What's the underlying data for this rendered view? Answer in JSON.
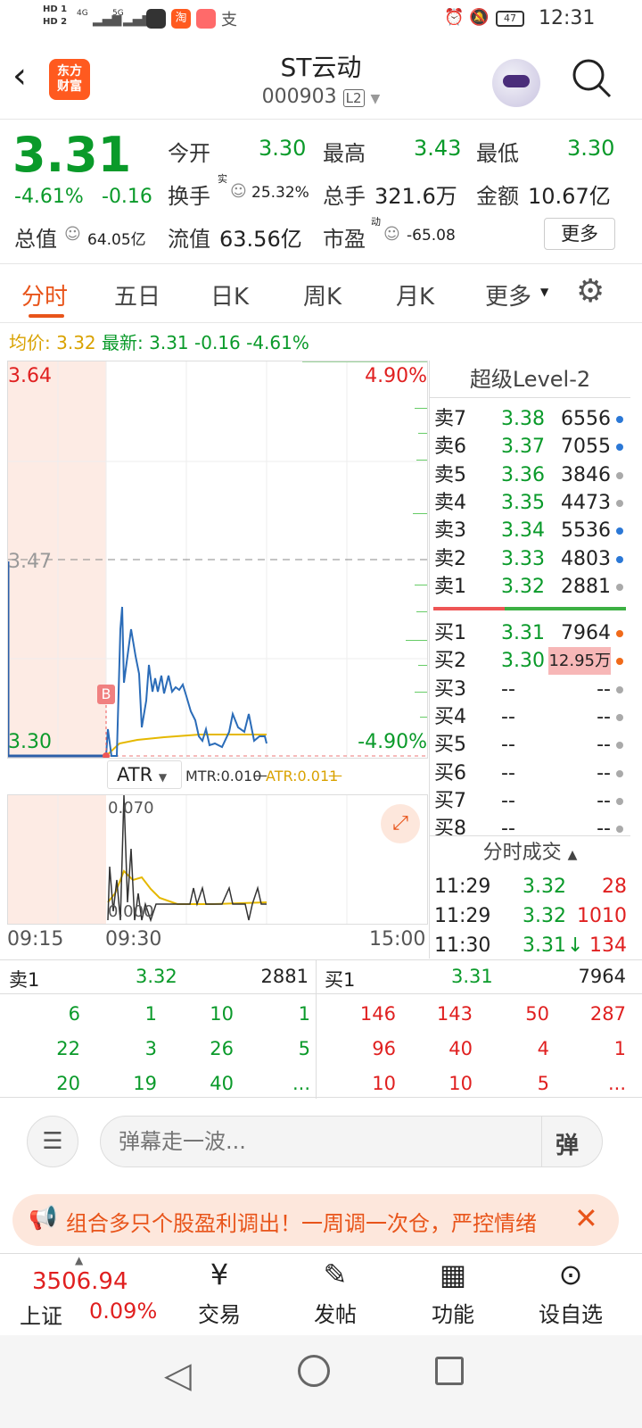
{
  "status_bar": {
    "sim1": "HD 1",
    "sim2": "HD 2",
    "net1": "4G",
    "net2": "5G",
    "battery": "47",
    "time": "12:31"
  },
  "header": {
    "logo_line1": "东方",
    "logo_line2": "财富",
    "title": "ST云动",
    "code": "000903",
    "level_badge": "L2"
  },
  "quote": {
    "price": "3.31",
    "change_pct": "-4.61%",
    "change": "-0.16",
    "open_label": "今开",
    "open": "3.30",
    "high_label": "最高",
    "high": "3.43",
    "low_label": "最低",
    "low": "3.30",
    "turnover_label": "换手",
    "turnover_sup": "实",
    "turnover": "25.32%",
    "volume_label": "总手",
    "volume": "321.6万",
    "amount_label": "金额",
    "amount": "10.67亿",
    "mktcap_label": "总值",
    "mktcap": "64.05亿",
    "float_label": "流值",
    "float": "63.56亿",
    "pe_label": "市盈",
    "pe_sup": "动",
    "pe": "-65.08",
    "more_button": "更多"
  },
  "tabs": [
    "分时",
    "五日",
    "日K",
    "周K",
    "月K",
    "更多"
  ],
  "info_line": {
    "avg_label": "均价:",
    "avg": "3.32",
    "latest_label": "最新:",
    "latest": "3.31",
    "change": "-0.16",
    "change_pct": "-4.61%"
  },
  "main_chart": {
    "y_top": "3.64",
    "y_mid": "3.47",
    "y_bottom": "3.30",
    "pct_top": "4.90%",
    "pct_bottom": "-4.90%",
    "marker": "B"
  },
  "indicator": {
    "name": "ATR",
    "mtr_label": "MTR:0.010",
    "atr_label": "ATR:0.011",
    "y_top": "0.070",
    "y_bottom": "0.000"
  },
  "time_axis": [
    "09:15",
    "09:30",
    "15:00"
  ],
  "level2": {
    "title": "超级Level-2",
    "asks": [
      {
        "label": "卖7",
        "price": "3.38",
        "vol": "6556",
        "dot": "#2b78d6"
      },
      {
        "label": "卖6",
        "price": "3.37",
        "vol": "7055",
        "dot": "#2b78d6"
      },
      {
        "label": "卖5",
        "price": "3.36",
        "vol": "3846",
        "dot": "#aaaaaa"
      },
      {
        "label": "卖4",
        "price": "3.35",
        "vol": "4473",
        "dot": "#aaaaaa"
      },
      {
        "label": "卖3",
        "price": "3.34",
        "vol": "5536",
        "dot": "#2b78d6"
      },
      {
        "label": "卖2",
        "price": "3.33",
        "vol": "4803",
        "dot": "#2b78d6"
      },
      {
        "label": "卖1",
        "price": "3.32",
        "vol": "2881",
        "dot": "#aaaaaa"
      }
    ],
    "bids": [
      {
        "label": "买1",
        "price": "3.31",
        "vol": "7964",
        "dot": "#f06a1a"
      },
      {
        "label": "买2",
        "price": "3.30",
        "vol": "12.95万",
        "dot": "#f06a1a"
      },
      {
        "label": "买3",
        "price": "--",
        "vol": "--",
        "dot": "#aaaaaa"
      },
      {
        "label": "买4",
        "price": "--",
        "vol": "--",
        "dot": "#aaaaaa"
      },
      {
        "label": "买5",
        "price": "--",
        "vol": "--",
        "dot": "#aaaaaa"
      },
      {
        "label": "买6",
        "price": "--",
        "vol": "--",
        "dot": "#aaaaaa"
      },
      {
        "label": "买7",
        "price": "--",
        "vol": "--",
        "dot": "#aaaaaa"
      },
      {
        "label": "买8",
        "price": "--",
        "vol": "--",
        "dot": "#aaaaaa"
      }
    ],
    "trades_title": "分时成交",
    "trades": [
      {
        "time": "11:29",
        "price": "3.32",
        "vol": "28",
        "arrow": ""
      },
      {
        "time": "11:29",
        "price": "3.32",
        "vol": "1010",
        "arrow": ""
      },
      {
        "time": "11:30",
        "price": "3.31",
        "vol": "134",
        "arrow": "↓"
      }
    ]
  },
  "order_queue": {
    "sell_label": "卖1",
    "sell_price": "3.32",
    "sell_total": "2881",
    "buy_label": "买1",
    "buy_price": "3.31",
    "buy_total": "7964",
    "sell_rows": [
      [
        "6",
        "1",
        "10",
        "1"
      ],
      [
        "22",
        "3",
        "26",
        "5"
      ],
      [
        "20",
        "19",
        "40",
        "..."
      ]
    ],
    "buy_rows": [
      [
        "146",
        "143",
        "50",
        "287"
      ],
      [
        "96",
        "40",
        "4",
        "1"
      ],
      [
        "10",
        "10",
        "5",
        "..."
      ]
    ]
  },
  "comment": {
    "placeholder": "弹幕走一波...",
    "danmaku_button": "弹"
  },
  "ticker": {
    "text": "组合多只个股盈利调出！一周调一次仓，严控情绪"
  },
  "tabbar": {
    "index_value": "3506.94",
    "index_name": "上证",
    "index_pct": "0.09%",
    "items": [
      "交易",
      "发帖",
      "功能",
      "设自选"
    ]
  }
}
